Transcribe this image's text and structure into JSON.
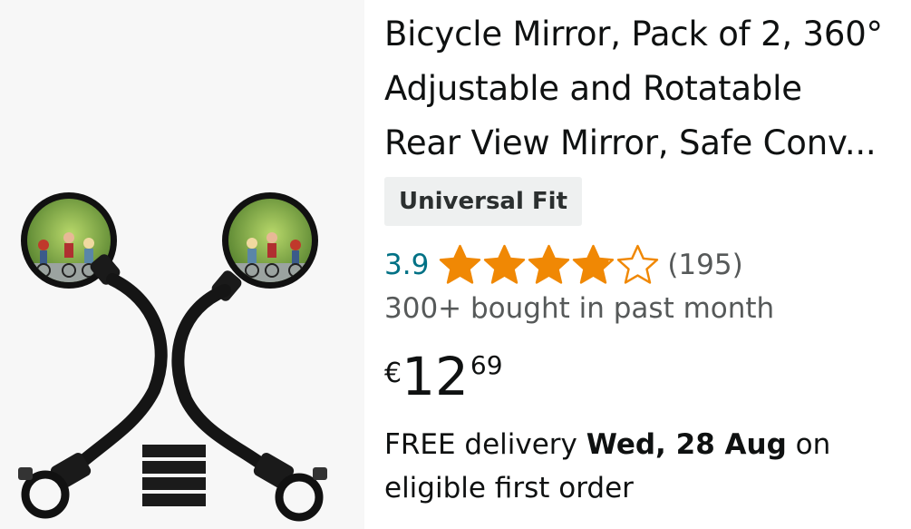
{
  "product": {
    "title_lines": [
      "Bicycle Mirror, Pack of 2, 360°",
      "Adjustable and Rotatable",
      "Rear View Mirror, Safe Conv..."
    ],
    "badge": "Universal Fit",
    "rating": "3.9",
    "rating_fraction": 0.78,
    "review_count": "(195)",
    "bought_text": "300+ bought in past month",
    "price": {
      "symbol": "€",
      "whole": "12",
      "fraction": "69"
    },
    "delivery": {
      "prefix": "FREE delivery ",
      "date": "Wed, 28 Aug",
      "suffix": " on",
      "line2": "eligible first order"
    }
  },
  "colors": {
    "star": "#f08804",
    "link": "#007185",
    "muted": "#565959",
    "badge_bg": "#eef0f0",
    "image_bg": "#f7f7f7"
  },
  "icons": {
    "product_image": "bicycle-mirror-pair-image",
    "star": "star-icon"
  }
}
